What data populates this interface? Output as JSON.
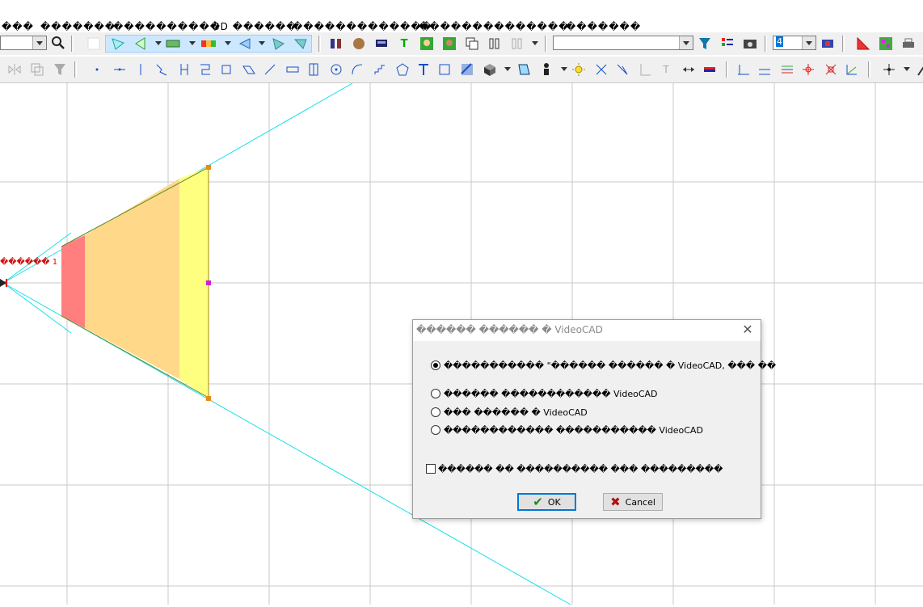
{
  "menu": {
    "items": [
      "���",
      "�������",
      "����������",
      "3D ������",
      "�������������",
      "������",
      "��������",
      "�������"
    ]
  },
  "toolbar": {
    "layer_combo_value": "",
    "count_combo_value": "4",
    "accent_selected": "#cce8ff"
  },
  "canvas": {
    "camera_label": "������ 1",
    "grid_color": "#c8c8c8",
    "view_line_color": "#19e0e8",
    "zone_colors": [
      "#ff7f7f",
      "#ffd88a",
      "#ffff7f"
    ]
  },
  "dialog": {
    "title": "������ ������ � VideoCAD",
    "close": "✕",
    "options": [
      {
        "label": "����������� \"������ ������ � VideoCAD, ��� ��",
        "selected": true
      },
      {
        "label": "������ ������������ VideoCAD",
        "selected": false
      },
      {
        "label": "��� ������ � VideoCAD",
        "selected": false
      },
      {
        "label": "������������ ����������� VideoCAD",
        "selected": false
      }
    ],
    "checkbox_label": "������ �� ���������� ��� ���������",
    "checkbox_checked": false,
    "ok_label": "OK",
    "cancel_label": "Cancel"
  }
}
